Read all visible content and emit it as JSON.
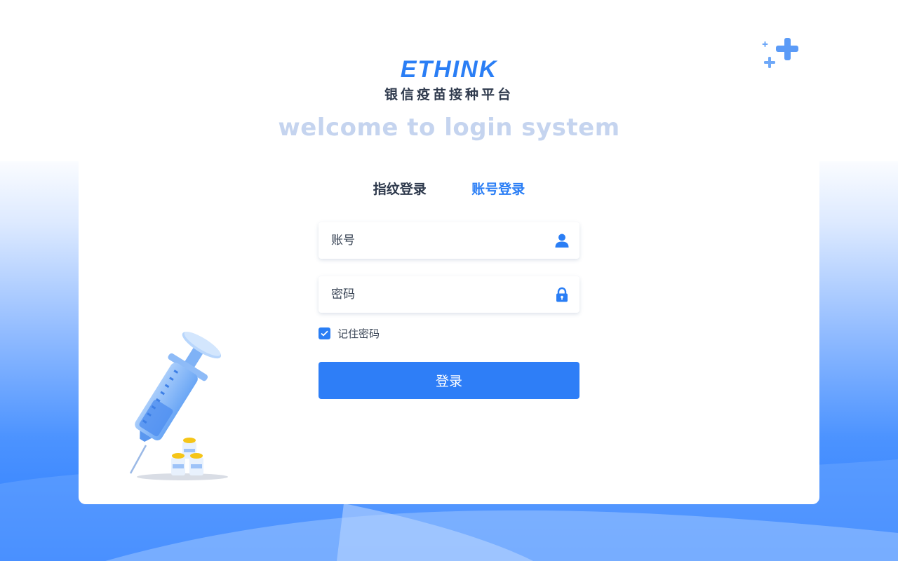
{
  "brand": {
    "logo": "ETHINK",
    "subtitle": "银信疫苗接种平台"
  },
  "welcome": "welcome to login system",
  "tabs": [
    {
      "label": "指纹登录",
      "active": false
    },
    {
      "label": "账号登录",
      "active": true
    }
  ],
  "form": {
    "account": {
      "placeholder": "账号",
      "value": "",
      "icon": "user-icon"
    },
    "password": {
      "placeholder": "密码",
      "value": "",
      "icon": "lock-icon"
    },
    "remember": {
      "label": "记住密码",
      "checked": true
    },
    "submit": "登录"
  },
  "colors": {
    "primary": "#2e7ef7",
    "text": "#2f3a4d",
    "welcome": "#c5d4ef"
  }
}
